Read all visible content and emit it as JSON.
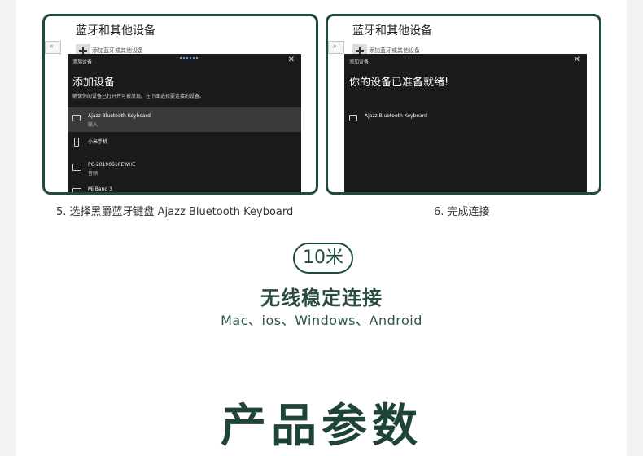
{
  "screenshot_left": {
    "settings_title": "蓝牙和其他设备",
    "settings_add": "添加蓝牙或其他设备",
    "dialog_bar": "添加设备",
    "close_glyph": "✕",
    "dialog_title": "添加设备",
    "dialog_sub": "确保你的设备已打开并可被发现。在下面选择要连接的设备。",
    "devices": [
      {
        "name": "Ajazz Bluetooth Keyboard",
        "type": "输入",
        "icon": "keyboard-icon"
      },
      {
        "name": "小米手机",
        "type": "",
        "icon": "phone-icon"
      },
      {
        "name": "PC-20190610EWHE",
        "type": "音频",
        "icon": "pc-icon"
      },
      {
        "name": "Mi Band 3",
        "type": "",
        "icon": "band-icon"
      }
    ]
  },
  "screenshot_right": {
    "settings_title": "蓝牙和其他设备",
    "settings_add": "添加蓝牙或其他设备",
    "dialog_bar": "添加设备",
    "close_glyph": "✕",
    "dialog_title": "你的设备已准备就绪!",
    "devices": [
      {
        "name": "Ajazz Bluetooth Keyboard",
        "type": "",
        "icon": "keyboard-icon"
      }
    ]
  },
  "captions": {
    "left": "5. 选择黑爵蓝牙键盘 Ajazz Bluetooth Keyboard",
    "right": "6. 完成连接"
  },
  "range_badge": "10米",
  "tagline": "无线稳定连接",
  "platforms": "Mac、ios、Windows、Android",
  "section_title": "产品参数",
  "colors": {
    "accent": "#1f4a3c",
    "dialog_bg": "#1b1b1b"
  }
}
